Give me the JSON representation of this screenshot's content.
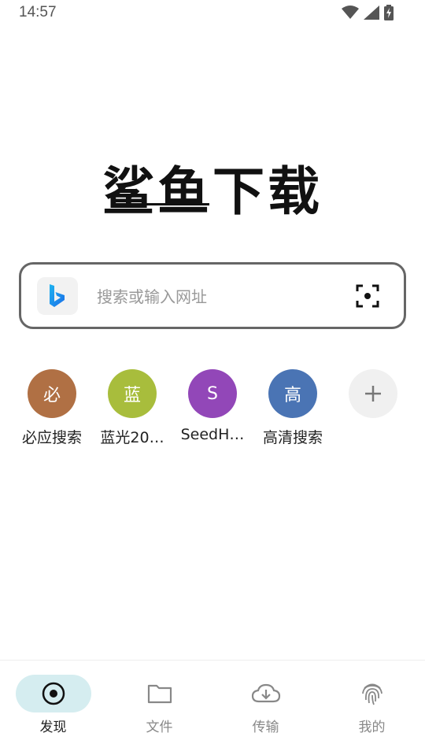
{
  "status_bar": {
    "time": "14:57"
  },
  "app": {
    "logo_text": "鲨鱼下载"
  },
  "search": {
    "placeholder": "搜索或输入网址"
  },
  "shortcuts": [
    {
      "label": "必应搜索",
      "glyph": "必",
      "color": "#b07044"
    },
    {
      "label": "蓝光20…",
      "glyph": "蓝",
      "color": "#a8bd3c"
    },
    {
      "label": "SeedH…",
      "glyph": "S",
      "color": "#9247b8"
    },
    {
      "label": "高清搜索",
      "glyph": "高",
      "color": "#4a74b4"
    }
  ],
  "bottom_nav": [
    {
      "label": "发现",
      "icon": "discover-icon",
      "active": true
    },
    {
      "label": "文件",
      "icon": "folder-icon",
      "active": false
    },
    {
      "label": "传输",
      "icon": "cloud-download-icon",
      "active": false
    },
    {
      "label": "我的",
      "icon": "fingerprint-icon",
      "active": false
    }
  ]
}
